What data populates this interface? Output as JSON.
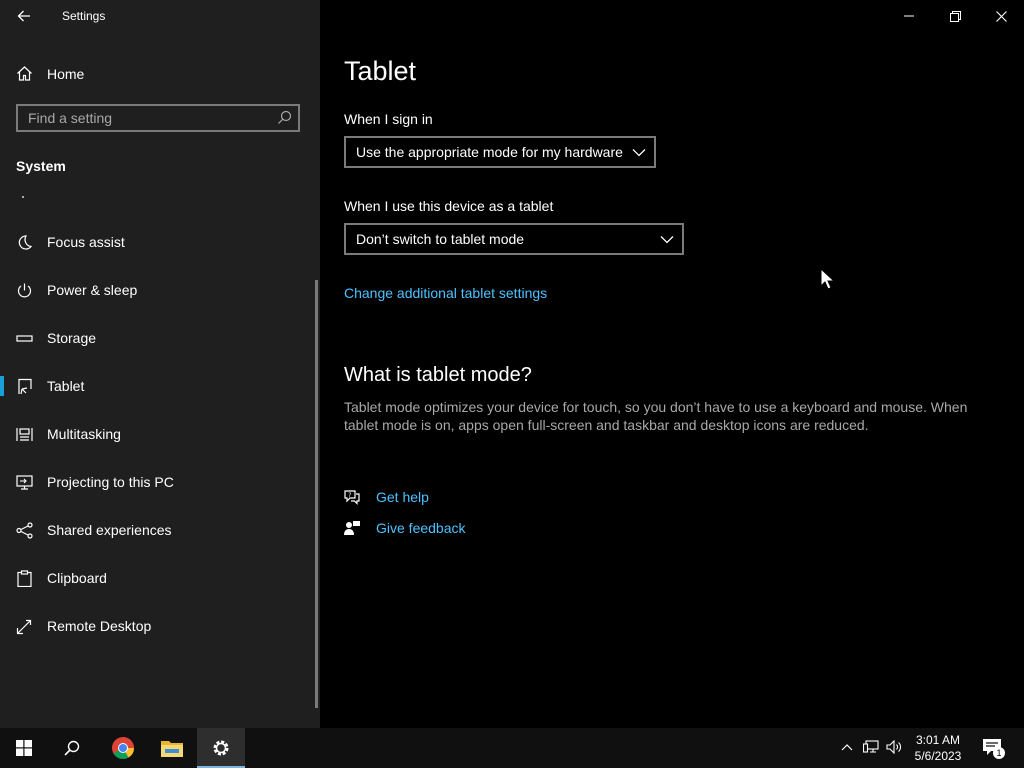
{
  "window": {
    "title": "Settings",
    "controls": [
      "minimize",
      "restore",
      "close"
    ]
  },
  "sidebar": {
    "home_label": "Home",
    "search_placeholder": "Find a setting",
    "section_title": "System",
    "items": [
      {
        "label": "Focus assist",
        "icon": "moon-icon"
      },
      {
        "label": "Power & sleep",
        "icon": "power-icon"
      },
      {
        "label": "Storage",
        "icon": "storage-icon"
      },
      {
        "label": "Tablet",
        "icon": "tablet-icon",
        "selected": true
      },
      {
        "label": "Multitasking",
        "icon": "multitasking-icon"
      },
      {
        "label": "Projecting to this PC",
        "icon": "projecting-icon"
      },
      {
        "label": "Shared experiences",
        "icon": "shared-experiences-icon"
      },
      {
        "label": "Clipboard",
        "icon": "clipboard-icon"
      },
      {
        "label": "Remote Desktop",
        "icon": "remote-desktop-icon"
      }
    ]
  },
  "main": {
    "title": "Tablet",
    "sign_in": {
      "label": "When I sign in",
      "value": "Use the appropriate mode for my hardware"
    },
    "tablet_use": {
      "label": "When I use this device as a tablet",
      "value": "Don’t switch to tablet mode"
    },
    "change_link": "Change additional tablet settings",
    "what_title": "What is tablet mode?",
    "what_body": "Tablet mode optimizes your device for touch, so you don’t have to use a keyboard and mouse. When tablet mode is on, apps open full-screen and taskbar and desktop icons are reduced.",
    "help": {
      "get_help": "Get help",
      "give_feedback": "Give feedback"
    }
  },
  "taskbar": {
    "pinned": [
      "start-icon",
      "search-icon",
      "chrome-icon",
      "file-explorer-icon",
      "settings-icon"
    ],
    "tray": [
      "chevron-up-icon",
      "network-icon",
      "volume-icon"
    ],
    "time": "3:01 AM",
    "date": "5/6/2023",
    "notification_count": "1"
  },
  "colors": {
    "accent": "#1aa0d8",
    "link": "#4cc2ff",
    "sidebar_bg": "#1f1f1f",
    "content_bg": "#000000",
    "taskbar_bg": "#101010"
  }
}
